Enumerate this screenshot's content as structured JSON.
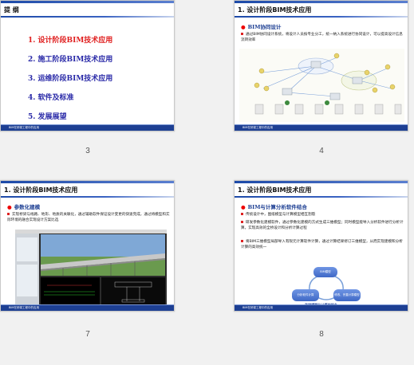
{
  "slides": [
    {
      "number": "3",
      "title": "提  纲",
      "outline": [
        "1. 设计阶段BIM技术应用",
        "2. 施工阶段BIM技术应用",
        "3. 运维阶段BIM技术应用",
        "4. 软件及标准",
        "5. 发展展望"
      ],
      "footer": "BIM在桥梁工程中的应用"
    },
    {
      "number": "4",
      "title": "1. 设计阶段BIM技术应用",
      "subhead": "BIM协同设计",
      "bullet": "通过BIM协同设计系统，将设计人员按专业分工，统一纳入系统进行协同设计，可以提高设计信息流转效率",
      "footer": "BIM在桥梁工程中的应用"
    },
    {
      "number": "7",
      "title": "1. 设计阶段BIM技术应用",
      "subhead": "参数化建模",
      "bullet": "实现桥梁与线路、地形、地质的关联化，通过辅助软件保证设计变更的快速完成，通过将模型和实际环境的融合实现设计方案比选",
      "footer": "BIM在桥梁工程中的应用"
    },
    {
      "number": "8",
      "title": "1. 设计阶段BIM技术应用",
      "subhead": "BIM与计算分析软件结合",
      "bullets": [
        "传统设计中，图纸模型与计算模型相互割裂",
        "研发参数化建模软件，通过参数化建模的方式生成三维模型；同时模型能导入分析软件进行分析计算，实现高效的全桥设计和分析计算过程",
        "将BIM三维模型局部导入有限元计算软件计算，通过计算结果修订三维模型，从而实现建模和分析计算的高效统一"
      ],
      "cycle": {
        "top": "BIM模型",
        "left": "分析软件计算",
        "right": "修改、完善计算模型"
      },
      "caption": "BIM模型与计算的结合",
      "footer": "BIM在桥梁工程中的应用"
    }
  ],
  "colors": {
    "accent_blue": "#1d3f93",
    "active_red": "#e02020",
    "outline_blue": "#2a2aa8"
  }
}
